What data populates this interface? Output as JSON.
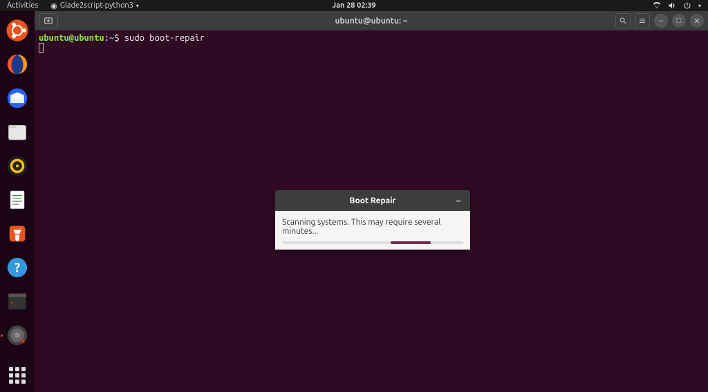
{
  "topbar": {
    "activities": "Activities",
    "app": "Glade2script-python3",
    "clock": "Jan 28  02:39"
  },
  "dock": {
    "items": [
      "ubuntu-logo",
      "firefox",
      "thunderbird",
      "files",
      "rhythmbox",
      "libreoffice-writer",
      "ubuntu-software",
      "help",
      "terminal",
      "boot-repair"
    ]
  },
  "terminal": {
    "title": "ubuntu@ubuntu: ~",
    "prompt_user_host": "ubuntu@ubuntu",
    "prompt_colon": ":",
    "prompt_path": "~",
    "prompt_dollar": "$ ",
    "command": "sudo boot-repair"
  },
  "dialog": {
    "title": "Boot Repair",
    "message": "Scanning systems. This may require several minutes..."
  }
}
